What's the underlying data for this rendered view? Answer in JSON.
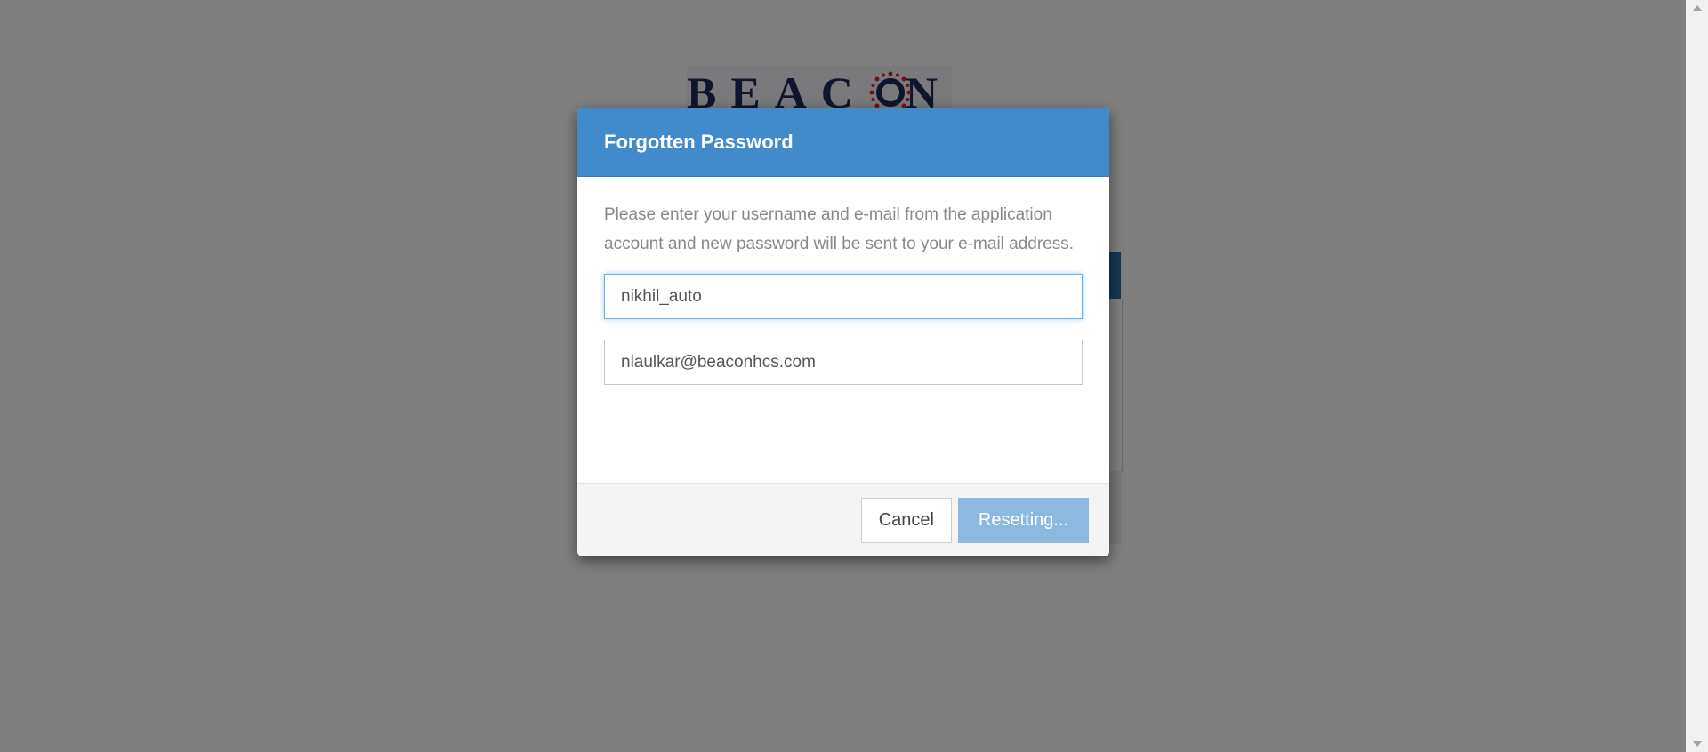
{
  "background": {
    "logo_text": "BEACON"
  },
  "modal": {
    "title": "Forgotten Password",
    "instructions": "Please enter your username and e-mail from the application account and new password will be sent to your e-mail address.",
    "username": {
      "value": "nikhil_auto",
      "focused": true
    },
    "email": {
      "value": "nlaulkar@beaconhcs.com"
    },
    "cancel_label": "Cancel",
    "submit_label": "Resetting..."
  },
  "colors": {
    "header_blue": "#428bca",
    "submit_disabled": "#8cb9e0",
    "overlay": "#7f7f7f"
  },
  "icons": {
    "scroll_up": "triangle-up",
    "scroll_down": "triangle-down"
  }
}
